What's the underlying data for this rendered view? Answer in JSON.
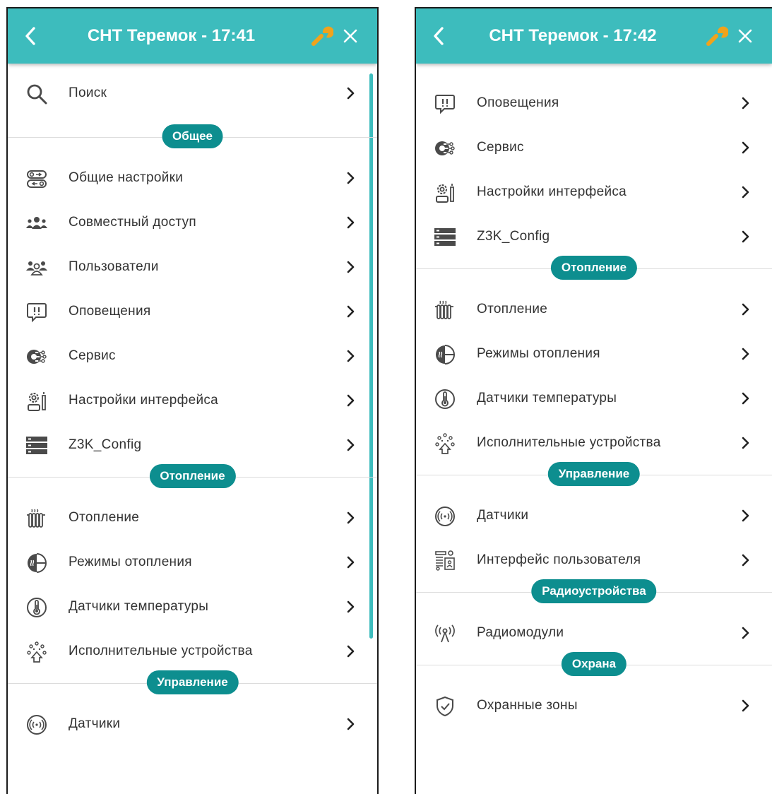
{
  "screens": [
    {
      "title": "СНТ Теремок - 17:41",
      "search_label": "Поиск",
      "sections": [
        {
          "title": "Общее",
          "items": [
            {
              "label": "Общие настройки",
              "icon": "general-settings-icon"
            },
            {
              "label": "Совместный доступ",
              "icon": "shared-access-icon"
            },
            {
              "label": "Пользователи",
              "icon": "users-icon"
            },
            {
              "label": "Оповещения",
              "icon": "notifications-icon"
            },
            {
              "label": "Сервис",
              "icon": "service-icon"
            },
            {
              "label": "Настройки интерфейса",
              "icon": "interface-settings-icon"
            },
            {
              "label": "Z3K_Config",
              "icon": "server-icon"
            }
          ]
        },
        {
          "title": "Отопление",
          "items": [
            {
              "label": "Отопление",
              "icon": "radiator-icon"
            },
            {
              "label": "Режимы отопления",
              "icon": "heating-modes-icon"
            },
            {
              "label": "Датчики температуры",
              "icon": "thermometer-icon"
            },
            {
              "label": "Исполнительные устройства",
              "icon": "actuator-icon"
            }
          ]
        },
        {
          "title": "Управление",
          "items": [
            {
              "label": "Датчики",
              "icon": "sensor-icon"
            }
          ]
        }
      ]
    },
    {
      "title": "СНТ Теремок - 17:42",
      "sections": [
        {
          "title": "",
          "items": [
            {
              "label": "Оповещения",
              "icon": "notifications-icon"
            },
            {
              "label": "Сервис",
              "icon": "service-icon"
            },
            {
              "label": "Настройки интерфейса",
              "icon": "interface-settings-icon"
            },
            {
              "label": "Z3K_Config",
              "icon": "server-icon"
            }
          ]
        },
        {
          "title": "Отопление",
          "items": [
            {
              "label": "Отопление",
              "icon": "radiator-icon"
            },
            {
              "label": "Режимы отопления",
              "icon": "heating-modes-icon"
            },
            {
              "label": "Датчики температуры",
              "icon": "thermometer-icon"
            },
            {
              "label": "Исполнительные устройства",
              "icon": "actuator-icon"
            }
          ]
        },
        {
          "title": "Управление",
          "items": [
            {
              "label": "Датчики",
              "icon": "sensor-icon"
            },
            {
              "label": "Интерфейс пользователя",
              "icon": "user-interface-icon"
            }
          ]
        },
        {
          "title": "Радиоустройства",
          "items": [
            {
              "label": "Радиомодули",
              "icon": "radio-module-icon"
            }
          ]
        },
        {
          "title": "Охрана",
          "items": [
            {
              "label": "Охранные зоны",
              "icon": "shield-icon"
            }
          ]
        }
      ]
    }
  ],
  "colors": {
    "header": "#3dbcbd",
    "pill": "#0d8e8f",
    "wrench": "#f0a31c"
  }
}
